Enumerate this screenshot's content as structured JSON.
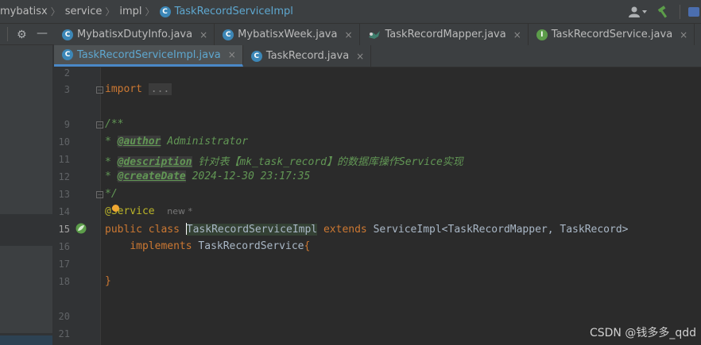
{
  "breadcrumb": {
    "items": [
      "mybatisx",
      "service",
      "impl"
    ],
    "current": "TaskRecordServiceImpl"
  },
  "tabs": {
    "row1": [
      {
        "label": "MybatisxDutyInfo.java",
        "icon": "java-class-icon"
      },
      {
        "label": "MybatisxWeek.java",
        "icon": "java-class-icon"
      },
      {
        "label": "TaskRecordMapper.java",
        "icon": "mybatis-mapper-icon"
      },
      {
        "label": "TaskRecordService.java",
        "icon": "java-interface-icon"
      }
    ],
    "row2": [
      {
        "label": "TaskRecordServiceImpl.java",
        "icon": "java-class-icon",
        "active": true
      },
      {
        "label": "TaskRecord.java",
        "icon": "java-class-icon"
      }
    ],
    "close_glyph": "×"
  },
  "gutter": {
    "lines": [
      "2",
      "3",
      "9",
      "10",
      "11",
      "12",
      "13",
      "14",
      "15",
      "16",
      "17",
      "18",
      "20",
      "21"
    ],
    "current_line": "15"
  },
  "code": {
    "import_kw": "import",
    "import_fold": "...",
    "doc_open": "/**",
    "star": "*",
    "author_tag": "@author",
    "author_val": "Administrator",
    "desc_tag": "@description",
    "desc_val": "针对表【mk_task_record】的数据库操作Service实现",
    "date_tag": "@createDate",
    "date_val": "2024-12-30 23:17:35",
    "doc_close": "*/",
    "annotation": "@Service",
    "inlay_hint": "new *",
    "public_kw": "public",
    "class_kw": "class",
    "class_name": "TaskRecordServiceImpl",
    "extends_kw": "extends",
    "super_type": "ServiceImpl<TaskRecordMapper, TaskRecord>",
    "implements_kw": "implements",
    "iface": "TaskRecordService",
    "open_brace": "{",
    "close_brace": "}"
  },
  "watermark": "CSDN @钱多多_qdd",
  "colors": {
    "editor_bg": "#2b2b2b",
    "keyword": "#cc7832",
    "doc_comment": "#629755",
    "annotation": "#bbb529",
    "active_tab_text": "#5ea7cf"
  }
}
